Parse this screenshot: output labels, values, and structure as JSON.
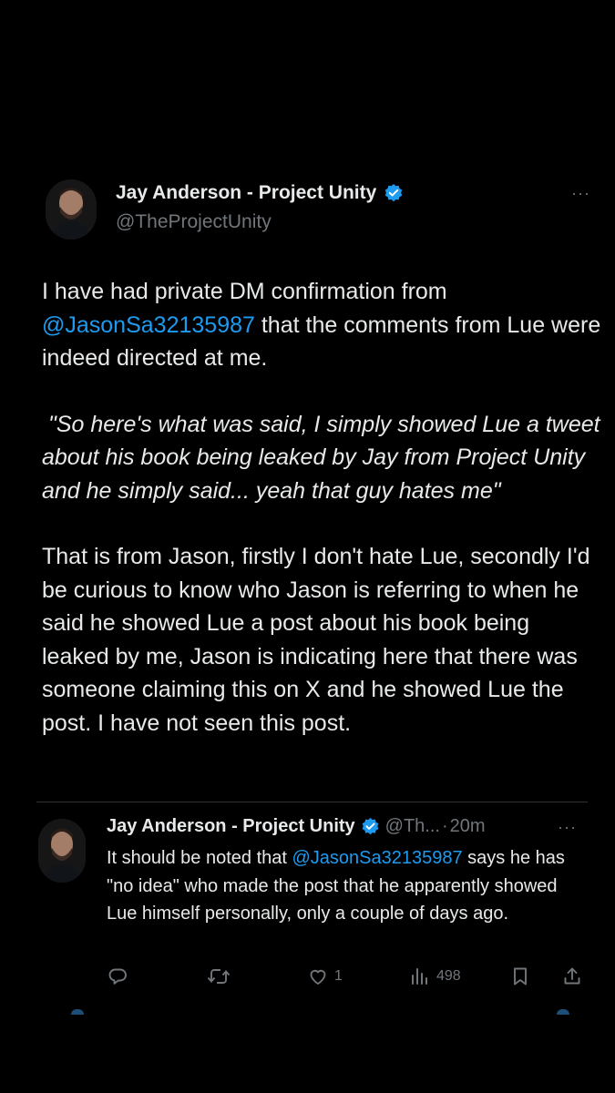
{
  "main_tweet": {
    "display_name": "Jay Anderson - Project Unity",
    "handle": "@TheProjectUnity",
    "more": "···",
    "paragraph1": {
      "before": "I have had private DM confirmation from ",
      "mention": "@JasonSa32135987",
      "after": " that the comments from Lue were indeed directed at me."
    },
    "quote": " \"So here's what was said, I simply showed Lue a tweet about his book being leaked by Jay from Project Unity and he simply said... yeah that guy hates me\"",
    "paragraph3": "That is from Jason, firstly I don't hate Lue, secondly I'd be curious to know who Jason is referring to when he said he showed Lue a post about his book being leaked by me, Jason is indicating here that there was someone claiming this on X and he showed Lue the post. I have not seen this post."
  },
  "reply_tweet": {
    "display_name": "Jay Anderson - Project Unity",
    "handle_truncated": "@Th...",
    "separator": "·",
    "time": "20m",
    "more": "···",
    "text": {
      "before": "It should be noted that ",
      "mention": "@JasonSa32135987",
      "after": " says he has \"no idea\" who made the post that he apparently showed Lue himself personally, only a couple of days ago."
    },
    "actions": {
      "reply_count": "",
      "retweet_count": "",
      "like_count": "1",
      "views_count": "498"
    }
  },
  "colors": {
    "background": "#000000",
    "text": "#e7e9ea",
    "secondary": "#71767b",
    "accent": "#1d9bf0"
  },
  "icons": {
    "verified": "verified-badge-icon",
    "reply": "reply-icon",
    "retweet": "retweet-icon",
    "like": "heart-icon",
    "views": "views-chart-icon",
    "bookmark": "bookmark-icon",
    "share": "share-icon"
  }
}
